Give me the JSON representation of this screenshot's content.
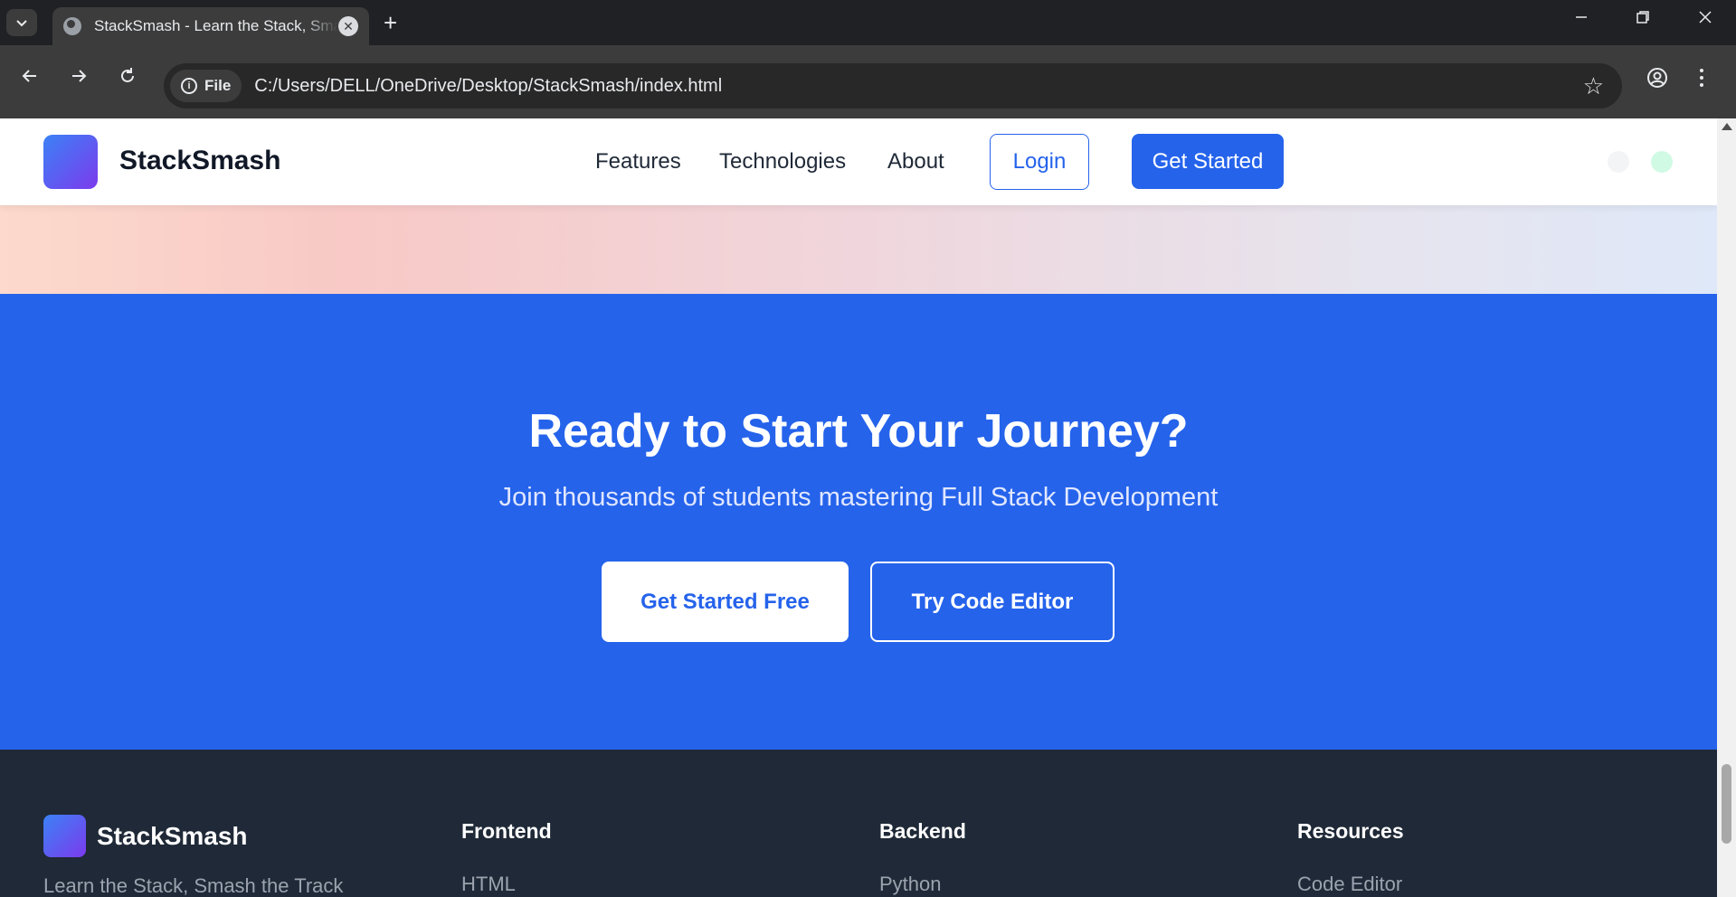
{
  "browser": {
    "tab_title": "StackSmash - Learn the Stack, Smash the Track",
    "new_tab": "+",
    "url_chip": "File",
    "url": "C:/Users/DELL/OneDrive/Desktop/StackSmash/index.html"
  },
  "nav": {
    "brand": "StackSmash",
    "links": [
      "Features",
      "Technologies",
      "About"
    ],
    "login": "Login",
    "get_started": "Get Started"
  },
  "cta": {
    "title": "Ready to Start Your Journey?",
    "subtitle": "Join thousands of students mastering Full Stack Development",
    "primary": "Get Started Free",
    "secondary": "Try Code Editor"
  },
  "footer": {
    "brand": "StackSmash",
    "tagline": "Learn the Stack, Smash the Track",
    "columns": [
      {
        "heading": "Frontend",
        "first_link": "HTML"
      },
      {
        "heading": "Backend",
        "first_link": "Python"
      },
      {
        "heading": "Resources",
        "first_link": "Code Editor"
      }
    ]
  },
  "colors": {
    "primary": "#2563eb",
    "footer_bg": "#1f2937",
    "logo_gradient_start": "#3b82f6",
    "logo_gradient_end": "#7c3aed"
  }
}
